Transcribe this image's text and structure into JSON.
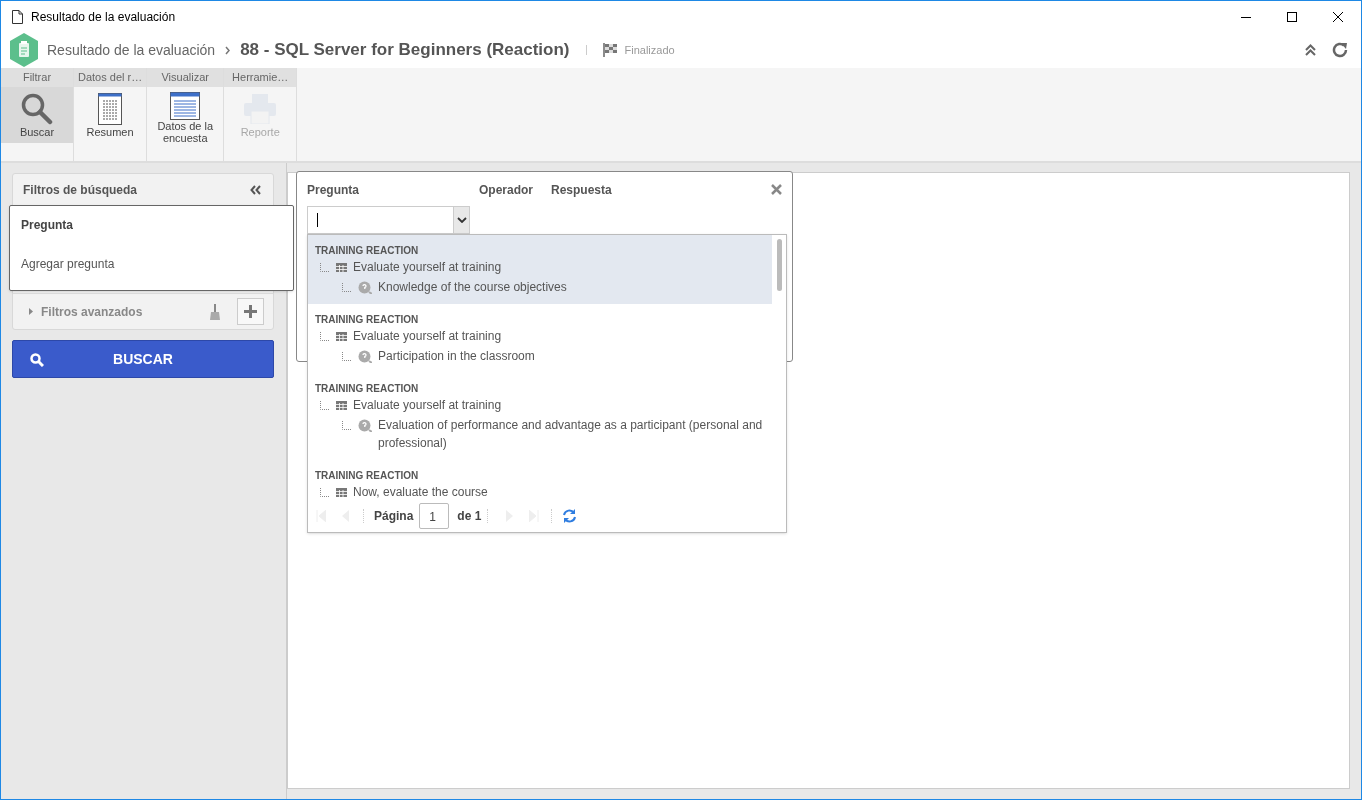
{
  "window": {
    "title": "Resultado de la evaluación"
  },
  "breadcrumb": {
    "parent": "Resultado de la evaluación",
    "current": "88 - SQL Server for Beginners (Reaction)",
    "status": "Finalizado"
  },
  "ribbon": {
    "groups": [
      {
        "label": "Filtrar",
        "buttons": [
          {
            "label": "Buscar",
            "selected": true,
            "disabled": false
          }
        ]
      },
      {
        "label": "Datos del r…",
        "buttons": [
          {
            "label": "Resumen",
            "selected": false,
            "disabled": false
          }
        ]
      },
      {
        "label": "Visualizar",
        "buttons": [
          {
            "label": "Datos de la encuesta",
            "selected": false,
            "disabled": false
          }
        ]
      },
      {
        "label": "Herramie…",
        "buttons": [
          {
            "label": "Reporte",
            "selected": false,
            "disabled": true
          }
        ]
      }
    ]
  },
  "filter_panel": {
    "title": "Filtros de búsqueda",
    "popup": {
      "title": "Pregunta",
      "link": "Agregar pregunta"
    },
    "advanced": "Filtros avanzados",
    "search_button": "BUSCAR"
  },
  "condition_popup": {
    "columns": [
      "Pregunta",
      "Operador",
      "Respuesta"
    ],
    "options": [
      {
        "category": "TRAINING REACTION",
        "section": "Evaluate yourself at training",
        "question": "Knowledge of the course objectives",
        "selected": true
      },
      {
        "category": "TRAINING REACTION",
        "section": "Evaluate yourself at training",
        "question": "Participation in the classroom",
        "selected": false
      },
      {
        "category": "TRAINING REACTION",
        "section": "Evaluate yourself at training",
        "question": "Evaluation of performance and advantage as a participant (personal and professional)",
        "selected": false
      },
      {
        "category": "TRAINING REACTION",
        "section": "Now, evaluate the course",
        "selected": false
      }
    ],
    "pager": {
      "label": "Página",
      "page": "1",
      "total": "de 1"
    }
  }
}
